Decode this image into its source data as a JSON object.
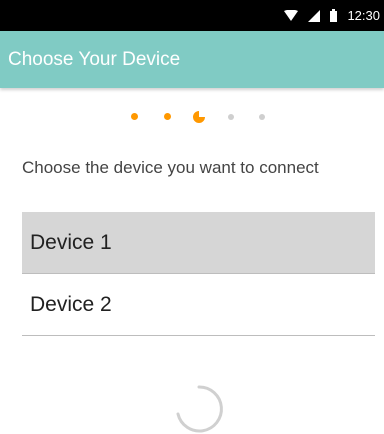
{
  "status_bar": {
    "time": "12:30",
    "icons": [
      "wifi-icon",
      "signal-icon",
      "battery-icon"
    ]
  },
  "app_bar": {
    "title": "Choose Your Device",
    "color": "#80cbc4"
  },
  "pager": {
    "total_steps": 5,
    "current_step": 3,
    "active_color": "#ff9800",
    "inactive_color": "#cfcfcf"
  },
  "main": {
    "instruction": "Choose the device you want to connect",
    "devices": [
      {
        "label": "Device 1",
        "selected": true
      },
      {
        "label": "Device 2",
        "selected": false
      }
    ]
  },
  "loading": {
    "icon": "loading-spinner-icon"
  }
}
